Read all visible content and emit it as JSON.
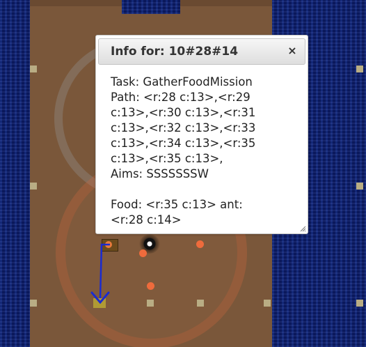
{
  "dialog": {
    "title": "Info for: 10#28#14",
    "close_symbol": "×",
    "task_line": "Task: GatherFoodMission",
    "path_lines": [
      "Path: <r:28 c:13>,<r:29",
      "c:13>,<r:30 c:13>,<r:31",
      "c:13>,<r:32 c:13>,<r:33",
      "c:13>,<r:34 c:13>,<r:35",
      "c:13>,<r:35 c:13>,"
    ],
    "aims_line": "Aims: SSSSSSSW",
    "blank_line": "",
    "food_lines": [
      "Food: <r:35 c:13> ant:",
      "<r:28 c:14>"
    ]
  },
  "icons": {
    "close": "close-icon",
    "resize": "resize-grip-icon",
    "anthill": "anthill-icon",
    "food": "food-pellet-icon",
    "path": "ant-path-arrow-icon"
  },
  "colors": {
    "ground": "#7a573a",
    "water": "#0b1c66",
    "food": "#ef6b3c",
    "path": "#1a2bd0",
    "marker": "#b9ad84"
  }
}
